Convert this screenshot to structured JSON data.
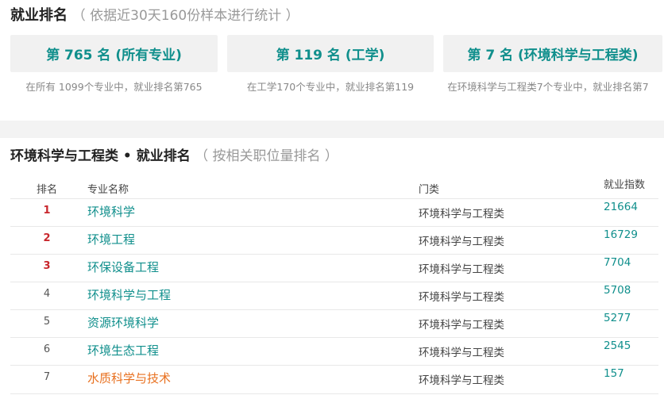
{
  "summary": {
    "title": "就业排名",
    "subtitle": "（ 依据近30天160份样本进行统计 ）",
    "cards": [
      {
        "label": "第 765 名 (所有专业)",
        "caption": "在所有 1099个专业中，就业排名第765"
      },
      {
        "label": "第 119 名 (工学)",
        "caption": "在工学170个专业中，就业排名第119"
      },
      {
        "label": "第 7 名 (环境科学与工程类)",
        "caption": "在环境科学与工程类7个专业中，就业排名第7"
      }
    ]
  },
  "ranking": {
    "title": "环境科学与工程类 • 就业排名",
    "subtitle": "（ 按相关职位量排名 ）",
    "headers": {
      "rank": "排名",
      "name": "专业名称",
      "category": "门类",
      "index": "就业指数"
    },
    "rows": [
      {
        "rank": "1",
        "name": "环境科学",
        "category": "环境科学与工程类",
        "index": "21664"
      },
      {
        "rank": "2",
        "name": "环境工程",
        "category": "环境科学与工程类",
        "index": "16729"
      },
      {
        "rank": "3",
        "name": "环保设备工程",
        "category": "环境科学与工程类",
        "index": "7704"
      },
      {
        "rank": "4",
        "name": "环境科学与工程",
        "category": "环境科学与工程类",
        "index": "5708"
      },
      {
        "rank": "5",
        "name": "资源环境科学",
        "category": "环境科学与工程类",
        "index": "5277"
      },
      {
        "rank": "6",
        "name": "环境生态工程",
        "category": "环境科学与工程类",
        "index": "2545"
      },
      {
        "rank": "7",
        "name": "水质科学与技术",
        "category": "环境科学与工程类",
        "index": "157"
      }
    ]
  }
}
